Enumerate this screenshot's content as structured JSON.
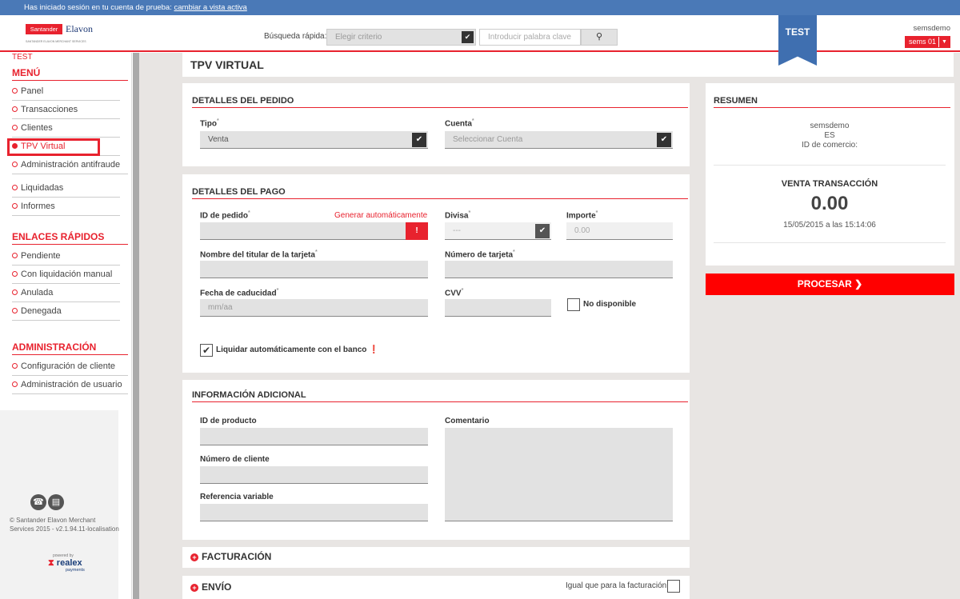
{
  "trial_bar": {
    "text": "Has iniciado sesión en tu cuenta de prueba:",
    "link": "cambiar a vista activa"
  },
  "logo": {
    "brand": "Santander",
    "partner": "Elavon",
    "sub": "SANTANDER ELAVON MERCHANT SERVICES"
  },
  "search": {
    "label": "Búsqueda rápida:",
    "criteria": "Elegir criterio",
    "placeholder": "Introducir palabra clave",
    "icon": "search-icon"
  },
  "env_badge": "TEST",
  "user": {
    "name": "semsdemo",
    "account": "sems 01"
  },
  "sidebar": {
    "env": "TEST",
    "menu_title": "MENÚ",
    "menu_items": [
      {
        "label": "Panel"
      },
      {
        "label": "Transacciones"
      },
      {
        "label": "Clientes"
      },
      {
        "label": "TPV Virtual",
        "active": true
      },
      {
        "label": "Administración antifraude"
      },
      {
        "label": "Liquidadas"
      },
      {
        "label": "Informes"
      }
    ],
    "quick_title": "ENLACES RÁPIDOS",
    "quick_items": [
      {
        "label": "Pendiente"
      },
      {
        "label": "Con liquidación manual"
      },
      {
        "label": "Anulada"
      },
      {
        "label": "Denegada"
      }
    ],
    "admin_title": "ADMINISTRACIÓN",
    "admin_items": [
      {
        "label": "Configuración de cliente"
      },
      {
        "label": "Administración de usuario"
      }
    ],
    "footer": {
      "copyright": "© Santander Elavon Merchant Services 2015 - v2.1.94.11-localisation",
      "powered": "powered by",
      "realex": "realex",
      "realex_sub": "payments"
    }
  },
  "page_title": "TPV VIRTUAL",
  "order": {
    "title": "DETALLES DEL PEDIDO",
    "tipo_label": "Tipo",
    "tipo_value": "Venta",
    "cuenta_label": "Cuenta",
    "cuenta_placeholder": "Seleccionar Cuenta"
  },
  "payment": {
    "title": "DETALLES DEL PAGO",
    "order_id_label": "ID de pedido",
    "auto_generate": "Generar automáticamente",
    "currency_label": "Divisa",
    "currency_value": "---",
    "amount_label": "Importe",
    "amount_value": "0.00",
    "holder_label": "Nombre del titular de la tarjeta",
    "card_number_label": "Número de tarjeta",
    "expiry_label": "Fecha de caducidad",
    "expiry_placeholder": "mm/aa",
    "cvv_label": "CVV",
    "cvv_na": "No disponible",
    "auto_settle_label": "Liquidar automáticamente con el banco"
  },
  "additional": {
    "title": "INFORMACIÓN ADICIONAL",
    "product_id_label": "ID de producto",
    "comment_label": "Comentario",
    "customer_number_label": "Número de cliente",
    "variable_ref_label": "Referencia variable"
  },
  "billing": {
    "title": "FACTURACIÓN"
  },
  "shipping": {
    "title": "ENVÍO",
    "same_as_billing": "Igual que para la facturación"
  },
  "summary": {
    "title": "RESUMEN",
    "merchant": "semsdemo",
    "country": "ES",
    "merchant_id_label": "ID de comercio:",
    "tx_type": "VENTA TRANSACCIÓN",
    "amount": "0.00",
    "datetime": "15/05/2015 a las 15:14:06"
  },
  "process_button": "PROCESAR",
  "colors": {
    "accent": "#e8222e",
    "topbar": "#4a79b7",
    "ribbon": "#3f6fb0"
  }
}
